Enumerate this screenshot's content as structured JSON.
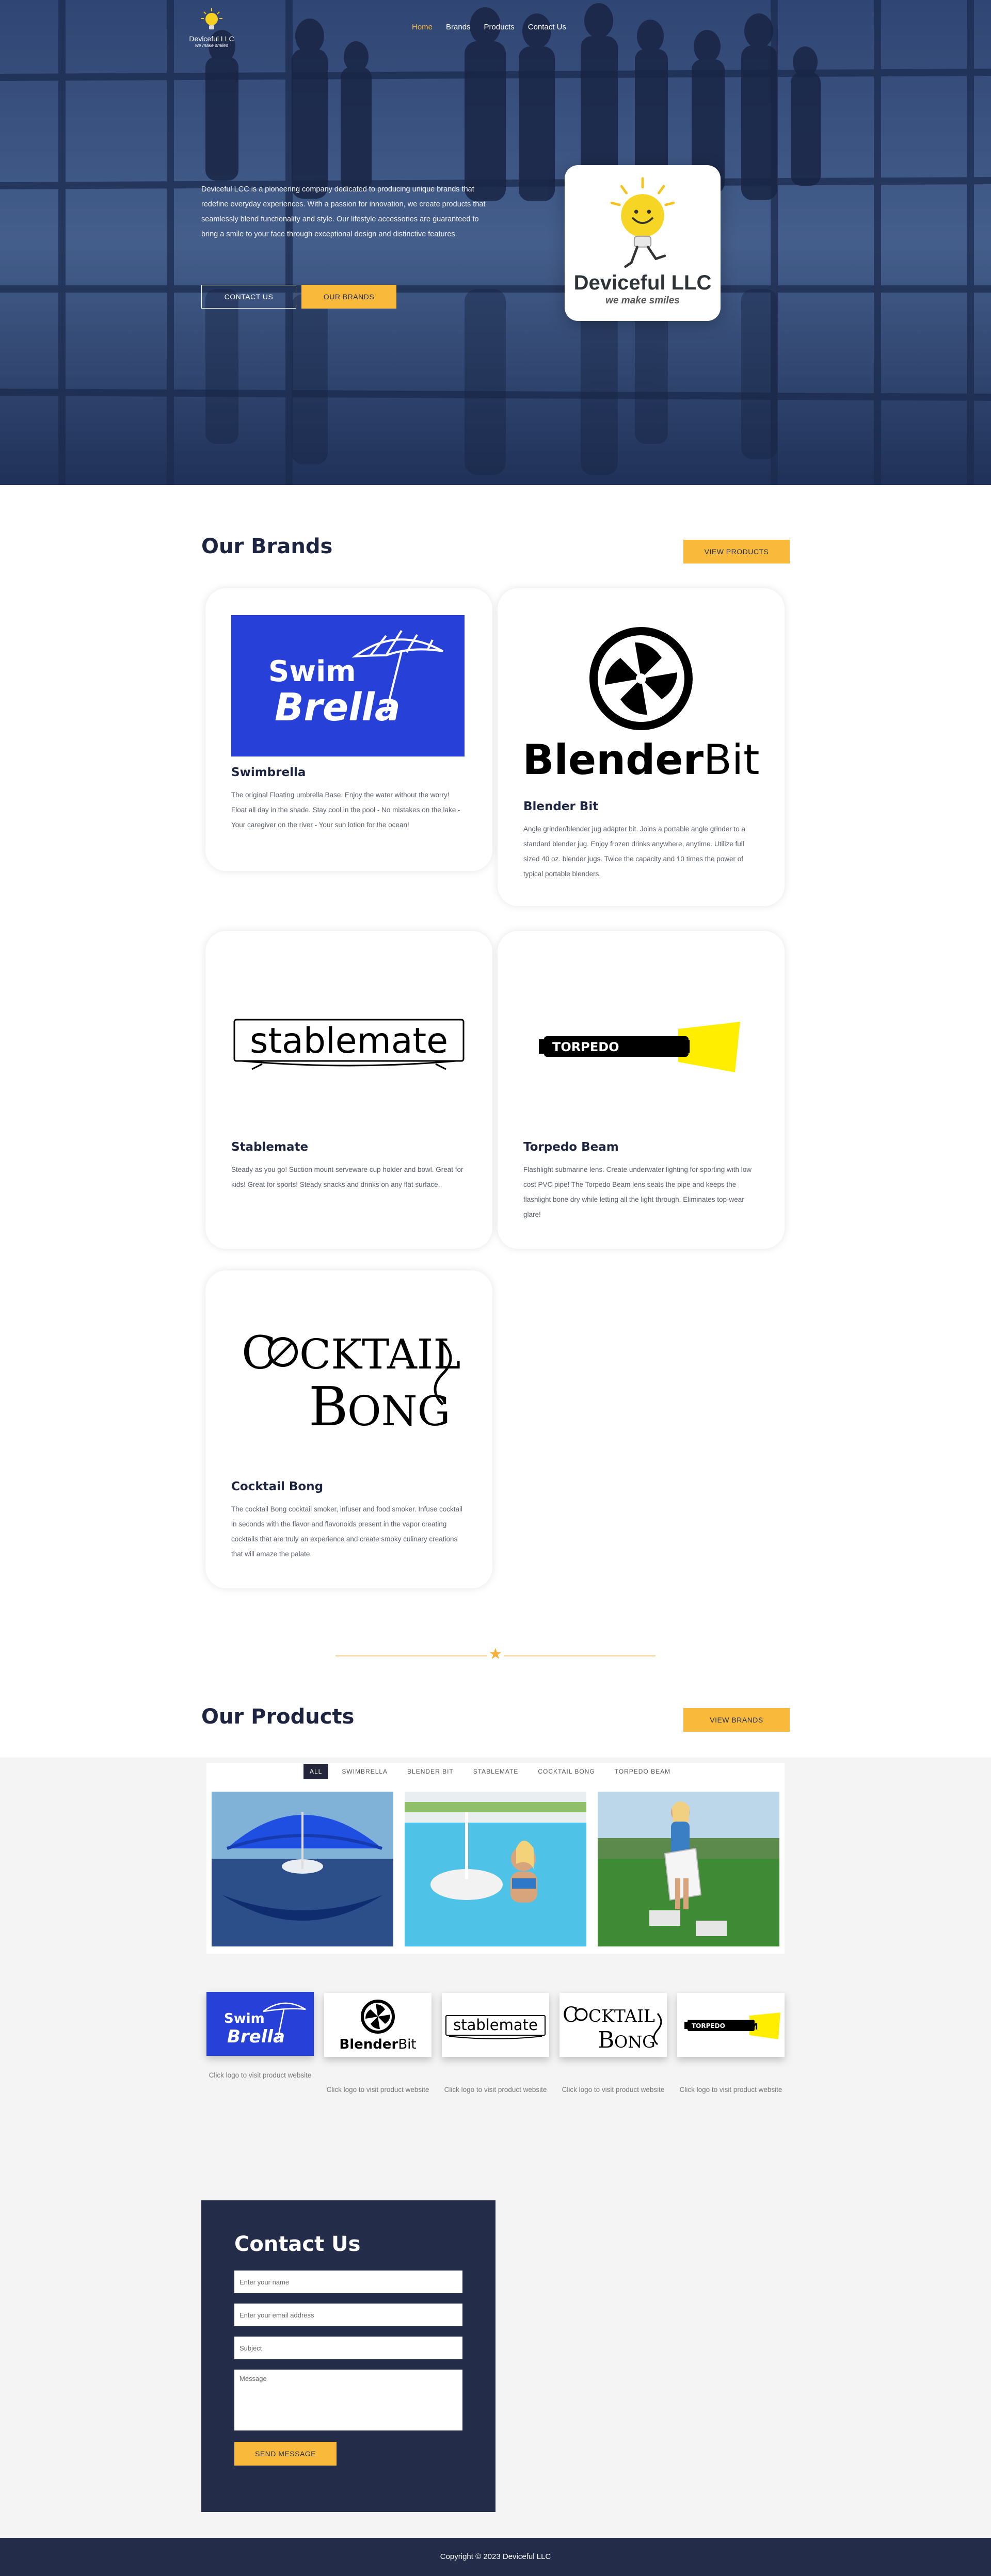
{
  "nav": {
    "logo_name": "Deviceful LLC",
    "logo_tagline": "we make smiles",
    "items": [
      "Home",
      "Brands",
      "Products",
      "Contact Us"
    ]
  },
  "hero": {
    "text": "Deviceful LCC is a pioneering company dedicated to producing unique brands that redefine everyday experiences. With a passion for innovation, we create products that seamlessly blend functionality and style. Our lifestyle accessories are guaranteed to bring a smile to your face through exceptional design and distinctive features.",
    "contact_btn": "CONTACT US",
    "brands_btn": "OUR BRANDS",
    "card_title": "Deviceful LLC",
    "card_tagline": "we make smiles"
  },
  "brands": {
    "title": "Our Brands",
    "view_btn": "VIEW PRODUCTS",
    "cards": [
      {
        "name": "Swimbrella",
        "logo": "SwimBrella",
        "desc": "The original Floating umbrella Base. Enjoy the water without the worry! Float all day in the shade. Stay cool in the pool - No mistakes on the lake - Your caregiver on the river - Your sun lotion for the ocean!"
      },
      {
        "name": "Blender Bit",
        "logo": "BlenderBit",
        "desc": "Angle grinder/blender jug adapter bit. Joins a portable angle grinder to a standard blender jug. Enjoy frozen drinks anywhere, anytime. Utilize full sized 40 oz. blender jugs. Twice the capacity and 10 times the power of typical portable blenders."
      },
      {
        "name": "Stablemate",
        "logo": "stablemate",
        "desc": "Steady as you go! Suction mount serveware cup holder and bowl. Great for kids! Great for sports! Steady snacks and drinks on any flat surface."
      },
      {
        "name": "Torpedo Beam",
        "logo": "TORPEDO BEAM",
        "desc": "Flashlight submarine lens. Create underwater lighting for sporting with low cost PVC pipe! The Torpedo Beam lens seats the pipe and keeps the flashlight bone dry while letting all the light through. Eliminates top-wear glare!"
      },
      {
        "name": "Cocktail Bong",
        "logo_line1": "COCKTAIL",
        "logo_line2": "BONG",
        "desc": "The cocktail Bong cocktail smoker, infuser and food smoker. Infuse cocktail in seconds with the flavor and flavonoids present in the vapor creating cocktails that are truly an experience and create smoky culinary creations that will amaze the palate."
      }
    ]
  },
  "products": {
    "title": "Our Products",
    "view_btn": "VIEW BRANDS",
    "filters": [
      "ALL",
      "SWIMBRELLA",
      "BLENDER BIT",
      "STABLEMATE",
      "COCKTAIL BONG",
      "TORPEDO BEAM"
    ],
    "logo_caption": "Click logo to visit product website"
  },
  "contact": {
    "title": "Contact Us",
    "name_ph": "Enter your name",
    "email_ph": "Enter your email address",
    "subject_ph": "Subject",
    "message_ph": "Message",
    "send": "SEND MESSAGE"
  },
  "footer": {
    "copyright": "Copyright © 2023 Deviceful LLC"
  },
  "colors": {
    "navy": "#232d4a",
    "accent": "#f9b93a",
    "hero_blue": "#324a74",
    "swimbrella_blue": "#2740d8"
  }
}
